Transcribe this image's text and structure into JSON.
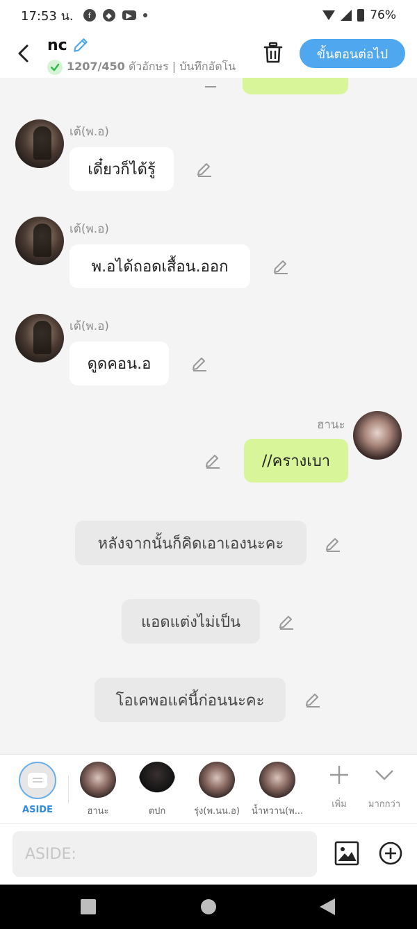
{
  "status_bar": {
    "time": "17:53 น.",
    "battery": "76%"
  },
  "header": {
    "title": "nc",
    "counter": "1207/450",
    "counter_suffix": "ตัวอักษร | บันทึกอัตโน",
    "next_button": "ขั้นตอนต่อไป"
  },
  "messages": [
    {
      "type": "other",
      "sender": "เต้(พ.อ)",
      "text": "เดี๋ยวก็ได้รู้"
    },
    {
      "type": "other",
      "sender": "เต้(พ.อ)",
      "text": "พ.อได้ถอดเสื้อน.ออก"
    },
    {
      "type": "other",
      "sender": "เต้(พ.อ)",
      "text": "ดูดคอน.อ"
    },
    {
      "type": "mine",
      "sender": "ฮานะ",
      "text": "//ครางเบา"
    },
    {
      "type": "narration",
      "text": "หลังจากนั้นก็คิดเอาเองนะคะ"
    },
    {
      "type": "narration",
      "text": "แอดแต่งไม่เป็น"
    },
    {
      "type": "narration",
      "text": "โอเคพอแค่นี้ก่อนนะคะ"
    }
  ],
  "characters": [
    {
      "label": "ASIDE",
      "active": true
    },
    {
      "label": "ฮานะ"
    },
    {
      "label": "ตปก"
    },
    {
      "label": "รุ่ง(พ.นน.อ)"
    },
    {
      "label": "น้ำหวาน(พ..."
    }
  ],
  "actions": {
    "more_label": "เพิ่ม",
    "expand_label": "มากกว่า"
  },
  "input": {
    "placeholder": "ASIDE:"
  },
  "colors": {
    "accent": "#4fa7f0",
    "mine_bubble": "#d9f59a",
    "narration_bubble": "#e9e9e9",
    "background": "#f4f4f4"
  }
}
